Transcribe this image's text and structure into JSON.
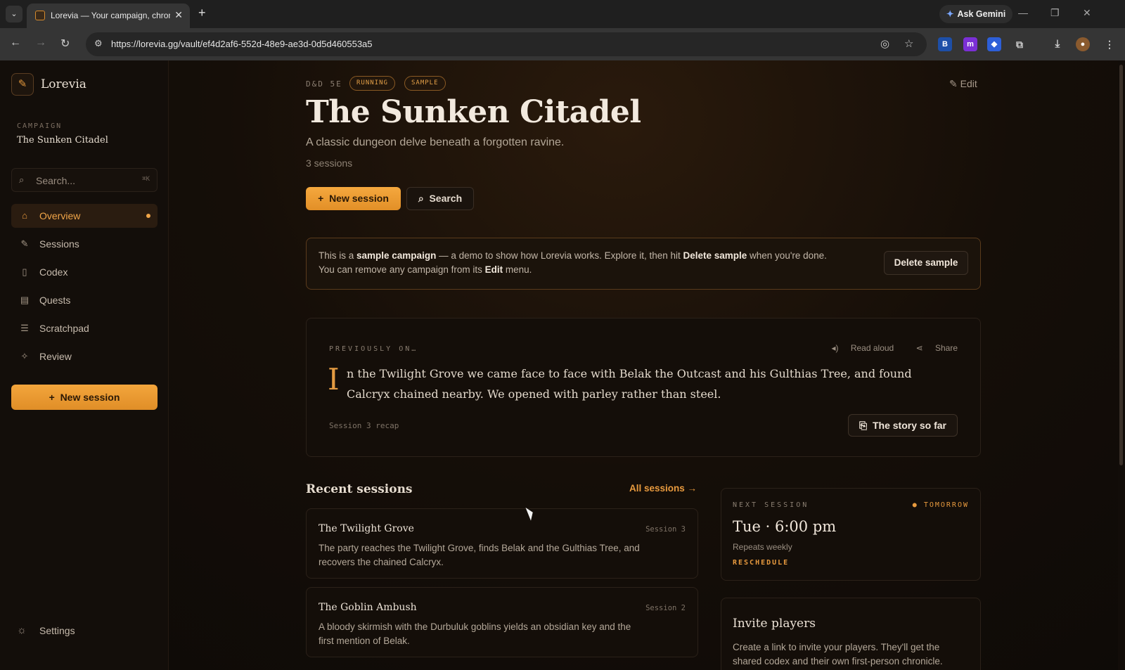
{
  "browser": {
    "tab_title": "Lorevia — Your campaign, chronicled",
    "tab_close": "✕",
    "new_tab": "+",
    "gemini_label": "Ask Gemini",
    "url": "https://lorevia.gg/vault/ef4d2af6-552d-48e9-ae3d-0d5d460553a5"
  },
  "sidebar": {
    "brand": "Lorevia",
    "campaign_label": "CAMPAIGN",
    "campaign_name": "The Sunken Citadel",
    "search_placeholder": "Search...",
    "search_shortcut": "⌘K",
    "nav": [
      {
        "label": "Overview",
        "icon": "home-icon"
      },
      {
        "label": "Sessions",
        "icon": "quill-icon"
      },
      {
        "label": "Codex",
        "icon": "book-icon"
      },
      {
        "label": "Quests",
        "icon": "scroll-icon"
      },
      {
        "label": "Scratchpad",
        "icon": "notepad-icon"
      },
      {
        "label": "Review",
        "icon": "sparkle-icon"
      }
    ],
    "new_session": "New session",
    "settings": "Settings"
  },
  "header": {
    "system": "D&D 5E",
    "badges": [
      "RUNNING",
      "SAMPLE"
    ],
    "edit": "Edit",
    "title": "The Sunken Citadel",
    "subtitle": "A classic dungeon delve beneath a forgotten ravine.",
    "session_count": "3 sessions",
    "new_session": "New session",
    "search": "Search"
  },
  "notice": {
    "l1_a": "This is a ",
    "l1_b": "sample campaign",
    "l1_c": " — a demo to show how Lorevia works. Explore it, then hit ",
    "l1_d": "Delete sample",
    "l1_e": " when you're done.",
    "l2_a": "You can remove any campaign from its ",
    "l2_b": "Edit",
    "l2_c": " menu.",
    "delete_button": "Delete sample"
  },
  "recap": {
    "kicker": "PREVIOUSLY ON…",
    "read_aloud": "Read aloud",
    "share": "Share",
    "dropcap": "I",
    "line1": "n the Twilight Grove we came face to face with Belak the Outcast and his Gulthias Tree, and found",
    "line2": "Calcryx chained nearby. We opened with parley rather than steel.",
    "footer": "Session 3 recap",
    "story_button": "The story so far"
  },
  "recent": {
    "heading": "Recent sessions",
    "all_link": "All sessions →",
    "sessions": [
      {
        "title": "The Twilight Grove",
        "number": "Session 3",
        "line1": "The party reaches the Twilight Grove, finds Belak and the Gulthias Tree, and",
        "line2": "recovers the chained Calcryx."
      },
      {
        "title": "The Goblin Ambush",
        "number": "Session 2",
        "line1": "A bloody skirmish with the Durbuluk goblins yields an obsidian key and the",
        "line2": "first mention of Belak."
      }
    ]
  },
  "next_session": {
    "kicker": "NEXT SESSION",
    "when": "● TOMORROW",
    "time": "Tue · 6:00 pm",
    "repeats": "Repeats weekly",
    "reschedule": "RESCHEDULE"
  },
  "invite": {
    "heading": "Invite players",
    "line1": "Create a link to invite your players. They'll get the",
    "line2": "shared codex and their own first-person chronicle."
  },
  "colors": {
    "accent": "#f0a548",
    "background": "#0f0b08"
  }
}
